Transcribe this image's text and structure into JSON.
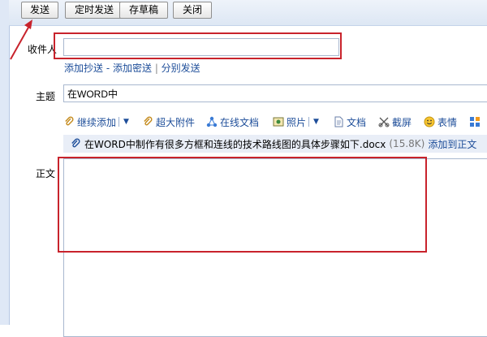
{
  "toolbar": {
    "send_label": "发送",
    "scheduled_send_label": "定时发送",
    "save_draft_label": "存草稿",
    "close_label": "关闭"
  },
  "recipient": {
    "label": "收件人",
    "value": "",
    "add_cc": "添加抄送",
    "sep1": " - ",
    "add_bcc": "添加密送",
    "sep2": " | ",
    "separate_send": "分别发送"
  },
  "subject": {
    "label": "主题",
    "value": "在WORD中"
  },
  "attach_toolbar": {
    "continue_add": "继续添加",
    "large_attachment": "超大附件",
    "online_doc": "在线文档",
    "photo": "照片",
    "document": "文档",
    "screenshot": "截屏",
    "emoji": "表情"
  },
  "attachment": {
    "filename": "在WORD中制作有很多方框和连线的技术路线图的具体步骤如下.docx",
    "size": "(15.8K)",
    "add_to_body": "添加到正文"
  },
  "body": {
    "label": "正文"
  },
  "colors": {
    "annotation_red": "#c8232c",
    "link_blue": "#1d4d99"
  }
}
